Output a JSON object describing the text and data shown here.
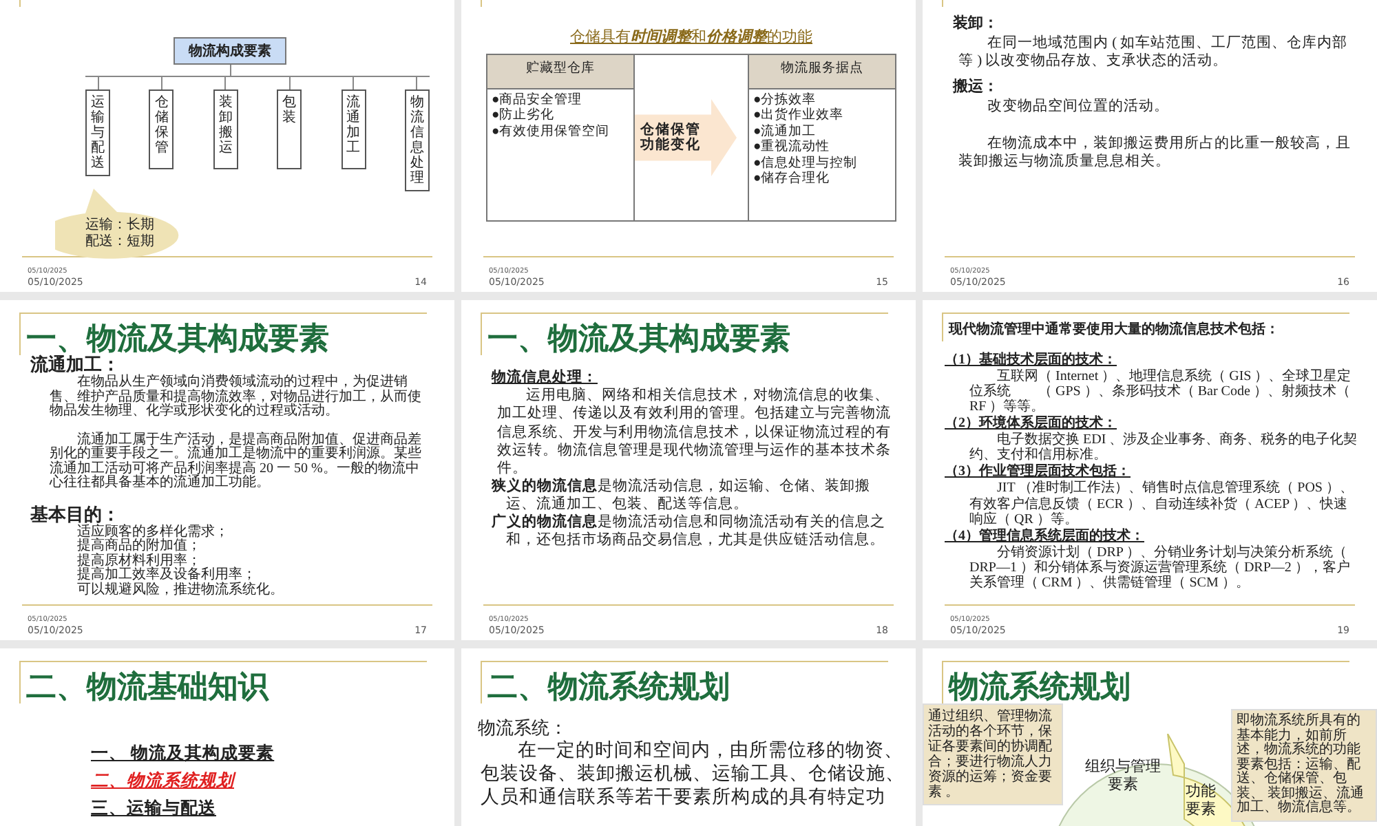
{
  "slides": [
    {
      "kind": "tree",
      "root": "物流构成要素",
      "branches": [
        "运输与配送",
        "仓储保管",
        "装卸搬运",
        "包装",
        "流通加工",
        "物流信息处理"
      ],
      "callout": [
        "运输：长期",
        "配送：短期"
      ],
      "date_small": "05/10/2025",
      "date": "05/10/2025",
      "number": "14"
    },
    {
      "kind": "table",
      "heading": [
        {
          "text": "仓储具有",
          "italic": false
        },
        {
          "text": "时间调整",
          "italic": true
        },
        {
          "text": "和",
          "italic": false
        },
        {
          "text": "价格调整",
          "italic": true
        },
        {
          "text": "的功能",
          "italic": false
        }
      ],
      "left": {
        "header": "贮藏型仓库",
        "items": [
          "●商品安全管理",
          "●防止劣化",
          "●有效使用保管空间"
        ]
      },
      "arrow": "仓储保管功能变化",
      "right": {
        "header": "物流服务据点",
        "items": [
          "●分拣效率",
          "●出货作业效率",
          "●流通加工",
          "●重视流动性",
          "●信息处理与控制",
          "●储存合理化"
        ]
      },
      "date_small": "05/10/2025",
      "date": "05/10/2025",
      "number": "15"
    },
    {
      "kind": "text",
      "blocks": [
        {
          "kind": "heading",
          "text": "装卸："
        },
        {
          "kind": "para",
          "text": "在同一地域范围内 ( 如车站范围、工厂范围、仓库内部等 ) 以改变物品存放、支承状态的活动。"
        },
        {
          "kind": "heading",
          "text": "搬运："
        },
        {
          "kind": "para",
          "text": "改变物品空间位置的活动。"
        },
        {
          "kind": "para",
          "text": "在物流成本中，装卸搬运费用所占的比重一般较高，且装卸搬运与物流质量息息相关。"
        }
      ],
      "date_small": "05/10/2025",
      "date": "05/10/2025",
      "number": "16"
    },
    {
      "kind": "text",
      "title": "一、物流及其构成要素",
      "blocks": [
        {
          "kind": "heading_large",
          "text": "流通加工："
        },
        {
          "kind": "small",
          "text": "在物品从生产领域向消费领域流动的过程中，为促进销售、维护产品质量和提高物流效率，对物品进行加工，从而使物品发生物理、化学或形状变化的过程或活动。"
        },
        {
          "kind": "small",
          "text": "流通加工属于生产活动，是提高商品附加值、促进商品差别化的重要手段之一。流通加工是物流中的重要利润源。某些流通加工活动可将产品利润率提高 20 一 50 %。一般的物流中心往往都具备基本的流通加工功能。"
        },
        {
          "kind": "heading_large",
          "text": "基本目的："
        },
        {
          "kind": "item",
          "text": "适应顾客的多样化需求；"
        },
        {
          "kind": "item",
          "text": "提高商品的附加值；"
        },
        {
          "kind": "item",
          "text": "提高原材料利用率；"
        },
        {
          "kind": "item",
          "text": "提高加工效率及设备利用率；"
        },
        {
          "kind": "item",
          "text": "可以规避风险，推进物流系统化。"
        }
      ],
      "date_small": "05/10/2025",
      "date": "05/10/2025",
      "number": "17"
    },
    {
      "kind": "text",
      "title": "一、物流及其构成要素",
      "blocks": [
        {
          "kind": "uheading",
          "text": "物流信息处理："
        },
        {
          "kind": "para",
          "text": "运用电脑、网络和相关信息技术，对物流信息的收集、加工处理、传递以及有效利用的管理。包括建立与完善物流信息系统、开发与利用物流信息技术，以保证物流过程的有效运转。物流信息管理是现代物流管理与运作的基本技术条件。"
        },
        {
          "kind": "hang",
          "text": "**狭义的物流信息**是物流活动信息，如运输、仓储、装卸搬运、流通加工、包装、配送等信息。"
        },
        {
          "kind": "hang",
          "text": "**广义的物流信息**是物流活动信息和同物流活动有关的信息之和，还包括市场商品交易信息，尤其是供应链活动信息。"
        }
      ],
      "date_small": "05/10/2025",
      "date": "05/10/2025",
      "number": "18"
    },
    {
      "kind": "text",
      "blocks": [
        {
          "kind": "lead",
          "text": "现代物流管理中通常要使用大量的物流信息技术包括："
        },
        {
          "kind": "uheading",
          "text": "（1）基础技术层面的技术："
        },
        {
          "kind": "para",
          "text": "互联网（ Internet ）、地理信息系统（ GIS ）、全球卫星定位系统　　（ GPS ）、条形码技术（ Bar Code ）、射频技术（ RF ）等等。"
        },
        {
          "kind": "uheading",
          "text": "（2）环境体系层面的技术："
        },
        {
          "kind": "para",
          "text": "电子数据交换 EDI 、涉及企业事务、商务、税务的电子化契约、支付和信用标准。"
        },
        {
          "kind": "uheading",
          "text": "（3）作业管理层面技术包括："
        },
        {
          "kind": "para",
          "text": "JIT （准时制工作法）、销售时点信息管理系统（ POS ）、有效客户信息反馈（ ECR ）、自动连续补货（ ACEP ）、快速响应（ QR ）等。"
        },
        {
          "kind": "uheading",
          "text": "（4）管理信息系统层面的技术："
        },
        {
          "kind": "para",
          "text": "分销资源计划（ DRP ）、分销业务计划与决策分析系统（ DRP—1 ）和分销体系与资源运营管理系统（ DRP—2 ），客户关系管理（ CRM ）、供需链管理（ SCM ）。"
        }
      ],
      "date_small": "05/10/2025",
      "date": "05/10/2025",
      "number": "19"
    },
    {
      "kind": "toc",
      "title": "二、物流基础知识",
      "items": [
        {
          "text": "一、 物流及其构成要素",
          "selected": false
        },
        {
          "text": "二、物流系统规划",
          "selected": true
        },
        {
          "text": "三、运输与配送",
          "selected": false
        }
      ]
    },
    {
      "kind": "text",
      "title": "二、物流系统规划",
      "blocks": [
        {
          "kind": "plain",
          "text": "物流系统："
        },
        {
          "kind": "para_large",
          "text": "在一定的时间和空间内，由所需位移的物资、包装设备、装卸搬运机械、运输工具、仓储设施、人员和通信联系等若干要素所构成的具有特定功"
        }
      ]
    },
    {
      "kind": "diagram",
      "title": "物流系统规划",
      "left_note": "通过组织、管理物流活动的各个环节，保证各要素间的协调配合；要进行物流人力资源的运筹；资金要素 。",
      "right_note": "即物流系统所具有的基本能力，如前所述，物流系统的功能要素包括：运输、配送、仓储保管、包装、 装卸搬运、流通加工、物流信息等。",
      "labels": [
        "组织与管理要素",
        "功能要素"
      ]
    }
  ]
}
